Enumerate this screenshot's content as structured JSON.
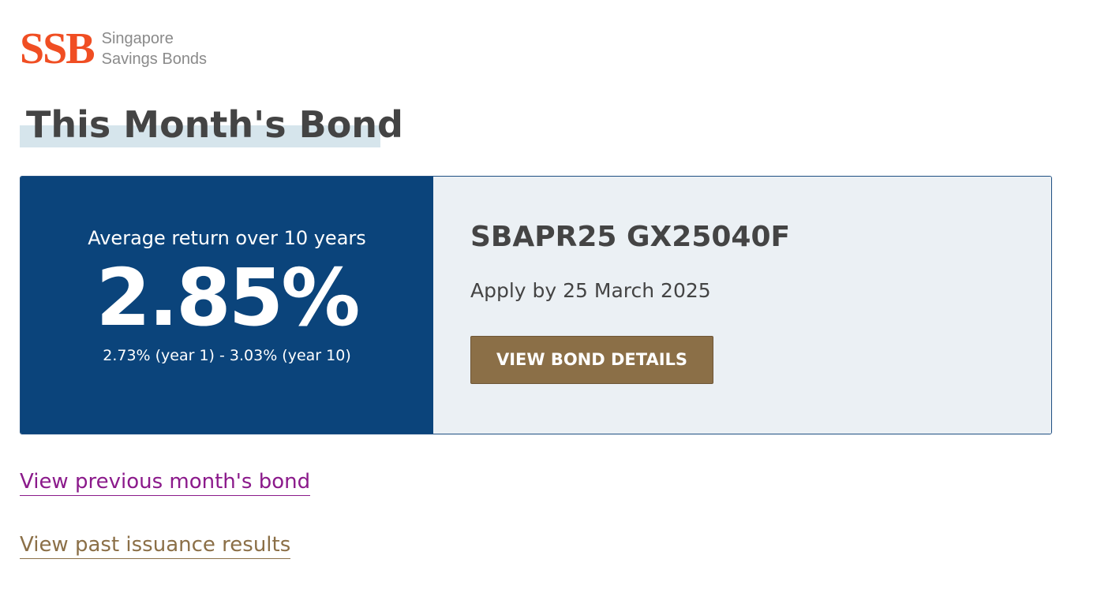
{
  "logo": {
    "mark": "SSB",
    "line1": "Singapore",
    "line2": "Savings Bonds"
  },
  "page_title": "This Month's Bond",
  "rate": {
    "label": "Average return over 10 years",
    "value": "2.85%",
    "range": "2.73% (year 1) - 3.03% (year 10)"
  },
  "bond": {
    "code": "SBAPR25 GX25040F",
    "apply_by": "Apply by 25 March 2025",
    "button_label": "VIEW BOND DETAILS"
  },
  "links": {
    "previous": "View previous month's bond",
    "past_results": "View past issuance results"
  },
  "colors": {
    "brand": "#f04e23",
    "panel_blue": "#0b447b",
    "panel_light": "#ebf0f4",
    "button": "#8b6f47",
    "link_visited": "#8b1a8b",
    "link": "#8b6f47"
  }
}
